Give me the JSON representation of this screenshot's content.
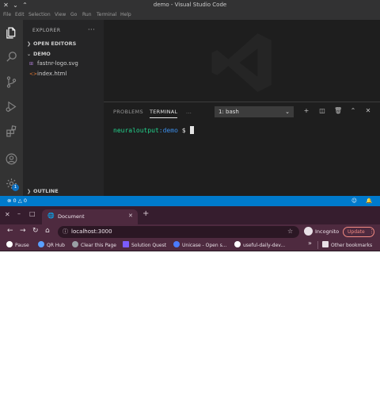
{
  "vscode": {
    "window_title": "demo - Visual Studio Code",
    "menu": [
      "File",
      "Edit",
      "Selection",
      "View",
      "Go",
      "Run",
      "Terminal",
      "Help"
    ],
    "sidebar": {
      "header": "EXPLORER",
      "more": "···",
      "open_editors": "OPEN EDITORS",
      "folder": "DEMO",
      "files": [
        {
          "name": "fastnr-logo.svg",
          "icon": "svg-file-icon",
          "icon_color": "#b180d7"
        },
        {
          "name": "index.html",
          "icon": "html-file-icon",
          "icon_color": "#e37933"
        }
      ],
      "outline": "OUTLINE"
    },
    "panel": {
      "tabs": [
        "PROBLEMS",
        "TERMINAL",
        "..."
      ],
      "terminal_select": "1: bash",
      "prompt_user": "neuraloutput",
      "prompt_path": ":demo",
      "prompt_symbol": " $ "
    },
    "activity_badge": "1",
    "status": {
      "errors": "0",
      "warnings": "0"
    },
    "colors": {
      "accent": "#007acc",
      "prompt_green": "#23d18b",
      "prompt_blue": "#3b8eea"
    }
  },
  "chrome": {
    "tab_title": "Document",
    "url": "localhost:3000",
    "incognito_label": "Incognito",
    "update_label": "Update",
    "bookmarks": [
      {
        "label": "Pause",
        "color": "#ffffff"
      },
      {
        "label": "QR Hub",
        "color": "#5aa0ff"
      },
      {
        "label": "Clear this Page",
        "color": "#9aa0a6"
      },
      {
        "label": "Solution Quest",
        "color": "#7b5cff"
      },
      {
        "label": "Unicase - Open s...",
        "color": "#4a7bff"
      },
      {
        "label": "useful-daily-dev...",
        "color": "#ffffff"
      }
    ],
    "other_bookmarks": "Other bookmarks",
    "colors": {
      "frame": "#361d2e",
      "toolbar": "#4e2a3f",
      "update": "#f28b82"
    }
  }
}
